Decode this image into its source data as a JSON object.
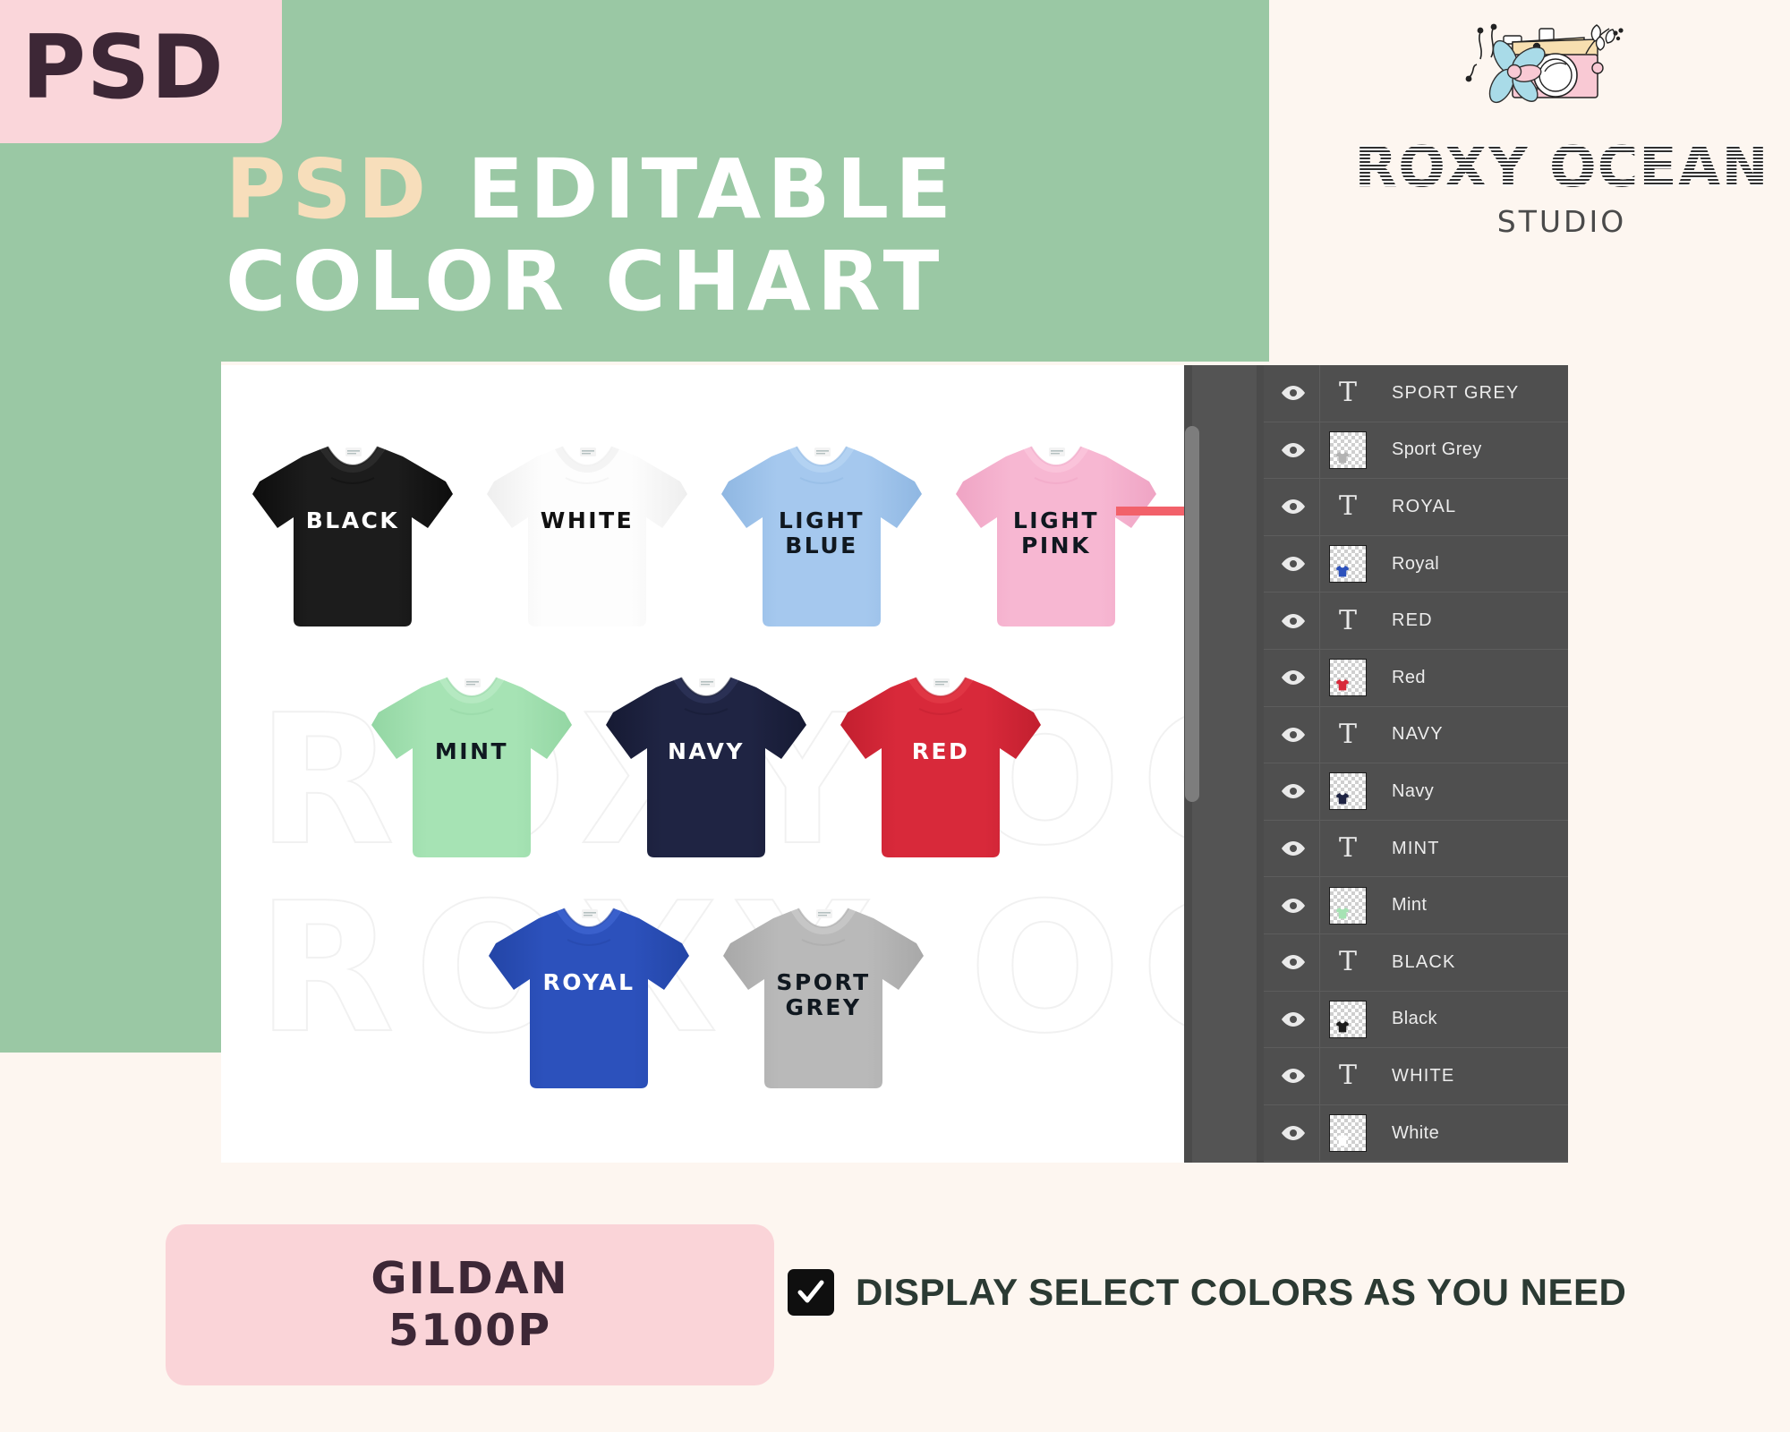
{
  "badge": {
    "psd_label": "PSD"
  },
  "header": {
    "title_line1_accent": "PSD",
    "title_line1_rest": "EDITABLE",
    "title_line2": "COLOR CHART",
    "green_bg": "#9ac8a4",
    "accent_cream": "#f7debb"
  },
  "logo": {
    "name": "ROXY OCEAN",
    "subtitle": "STUDIO",
    "icon": "camera-flower-icon",
    "camera_body_color": "#f9c9d4",
    "camera_top_color": "#f7dfb0",
    "flower_color": "#a9dbe8"
  },
  "canvas": {
    "watermark_line1": "ROXY OCEAN",
    "watermark_line2": "ROXY OCEAN",
    "arrow": "right-arrow-icon",
    "arrow_color": "#f2616a",
    "shirts": [
      [
        {
          "label": "BLACK",
          "color": "#1c1c1c",
          "text_color": "#ffffff",
          "shade": "#0d0d0d",
          "collar": "#2a2a2a"
        },
        {
          "label": "WHITE",
          "color": "#fdfdfd",
          "text_color": "#111111",
          "shade": "#eeeeee",
          "collar": "#f4f4f4"
        },
        {
          "label": "LIGHT\nBLUE",
          "color": "#a5c8ee",
          "text_color": "#101820",
          "shade": "#8fb7e2",
          "collar": "#b3d2f2"
        },
        {
          "label": "LIGHT\nPINK",
          "color": "#f7b7d2",
          "text_color": "#101820",
          "shade": "#efa4c4",
          "collar": "#fac3da"
        }
      ],
      [
        {
          "label": "MINT",
          "color": "#a6e3b4",
          "text_color": "#101820",
          "shade": "#93d6a3",
          "collar": "#b5e9c1"
        },
        {
          "label": "NAVY",
          "color": "#1f2443",
          "text_color": "#ffffff",
          "shade": "#161a33",
          "collar": "#2a3054"
        },
        {
          "label": "RED",
          "color": "#d8293a",
          "text_color": "#ffffff",
          "shade": "#c21f2f",
          "collar": "#e03644"
        }
      ],
      [
        {
          "label": "ROYAL",
          "color": "#2c51bc",
          "text_color": "#ffffff",
          "shade": "#2345a6",
          "collar": "#3a60cc"
        },
        {
          "label": "SPORT\nGREY",
          "color": "#b9b9b9",
          "text_color": "#101820",
          "shade": "#a8a8a8",
          "collar": "#c6c6c6"
        }
      ]
    ]
  },
  "layers_panel": {
    "rows": [
      {
        "type": "text",
        "name": "SPORT  GREY",
        "icon": "type-layer-icon",
        "visible_icon": "eye-icon",
        "tee_color": "#9e9e9e"
      },
      {
        "type": "image",
        "name": "Sport Grey",
        "icon": "layer-thumbnail",
        "visible_icon": "eye-icon",
        "tee_color": "#b3b3b3"
      },
      {
        "type": "text",
        "name": "ROYAL",
        "icon": "type-layer-icon",
        "visible_icon": "eye-icon",
        "tee_color": "#2c51bc"
      },
      {
        "type": "image",
        "name": "Royal",
        "icon": "layer-thumbnail",
        "visible_icon": "eye-icon",
        "tee_color": "#2c51bc"
      },
      {
        "type": "text",
        "name": "RED",
        "icon": "type-layer-icon",
        "visible_icon": "eye-icon",
        "tee_color": "#d8293a"
      },
      {
        "type": "image",
        "name": "Red",
        "icon": "layer-thumbnail",
        "visible_icon": "eye-icon",
        "tee_color": "#d8293a"
      },
      {
        "type": "text",
        "name": "NAVY",
        "icon": "type-layer-icon",
        "visible_icon": "eye-icon",
        "tee_color": "#1f2443"
      },
      {
        "type": "image",
        "name": "Navy",
        "icon": "layer-thumbnail",
        "visible_icon": "eye-icon",
        "tee_color": "#1f2443"
      },
      {
        "type": "text",
        "name": "MINT",
        "icon": "type-layer-icon",
        "visible_icon": "eye-icon",
        "tee_color": "#a6e3b4"
      },
      {
        "type": "image",
        "name": "Mint",
        "icon": "layer-thumbnail",
        "visible_icon": "eye-icon",
        "tee_color": "#a6e3b4"
      },
      {
        "type": "text",
        "name": "BLACK",
        "icon": "type-layer-icon",
        "visible_icon": "eye-icon",
        "tee_color": "#1c1c1c"
      },
      {
        "type": "image",
        "name": "Black",
        "icon": "layer-thumbnail",
        "visible_icon": "eye-icon",
        "tee_color": "#1c1c1c"
      },
      {
        "type": "text",
        "name": "WHITE",
        "icon": "type-layer-icon",
        "visible_icon": "eye-icon",
        "tee_color": "#ffffff"
      },
      {
        "type": "image",
        "name": "White",
        "icon": "layer-thumbnail",
        "visible_icon": "eye-icon",
        "tee_color": "#ffffff"
      }
    ],
    "panel_bg": "#4f4f4f"
  },
  "footer": {
    "product_brand": "GILDAN",
    "product_model": "5100P",
    "note": "DISPLAY SELECT COLORS AS YOU NEED",
    "checkbox_checked": true,
    "badge_color": "#fad4d8"
  }
}
